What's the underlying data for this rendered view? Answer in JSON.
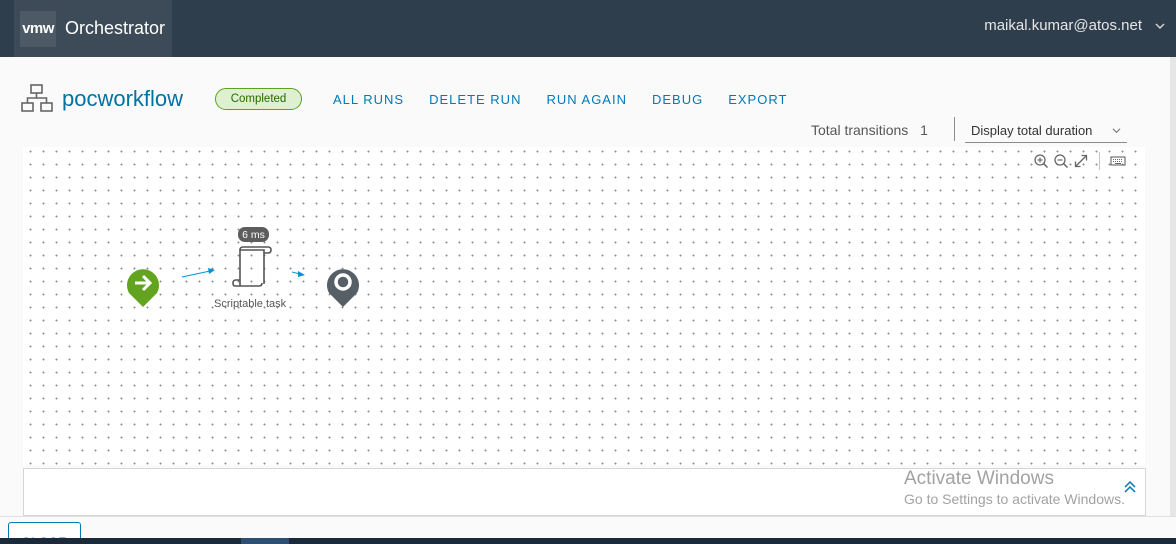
{
  "header": {
    "logo": "vmw",
    "app_title": "Orchestrator",
    "user": "maikal.kumar@atos.net"
  },
  "workflow": {
    "name": "pocworkflow",
    "status": "Completed",
    "status_color": "#5aa220"
  },
  "actions": [
    "ALL RUNS",
    "DELETE RUN",
    "RUN AGAIN",
    "DEBUG",
    "EXPORT"
  ],
  "stats": {
    "transitions_label": "Total transitions",
    "transitions_count": "1",
    "duration_select": "Display total duration"
  },
  "canvas": {
    "toolbar_icons": [
      "zoom-in-icon",
      "zoom-out-icon",
      "fit-icon",
      "keyboard-icon"
    ],
    "nodes": {
      "start": {
        "icon": "arrow-right-icon",
        "color": "#62a420"
      },
      "task": {
        "label": "Scriptable task",
        "duration": "6 ms",
        "icon": "scroll-icon"
      },
      "end": {
        "icon": "map-pin-icon",
        "color": "#565e66"
      }
    },
    "connector_color": "#0095d3"
  },
  "bottom": {
    "close_label": "CLOSE"
  },
  "watermark": {
    "title": "Activate Windows",
    "subtitle": "Go to Settings to activate Windows."
  }
}
